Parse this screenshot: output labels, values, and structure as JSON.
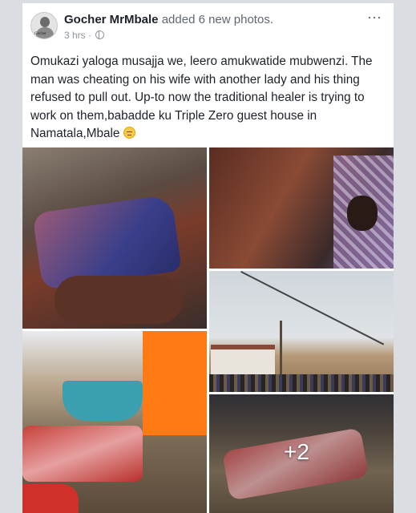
{
  "post": {
    "author": "Gocher MrMbale",
    "action": "added 6 new photos.",
    "time": "3 hrs",
    "separator": "·",
    "audience_icon": "globe-icon",
    "menu_icon": "more-options-icon",
    "menu_glyph": "⋯",
    "text": "Omukazi yaloga musajja we,  leero amukwatide mubwenzi. The man was cheating on his wife with another lady and his thing refused to pull out. Up-to now the traditional healer is trying to work on them,babadde ku Triple Zero guest house in Namatala,Mbale",
    "emoji_icon": "grimacing-face-emoji"
  },
  "avatar": {
    "caption": "Gocher"
  },
  "photos": {
    "count_total": 6,
    "more_label": "+2"
  },
  "colors": {
    "name": "#1d2129",
    "meta": "#90949c",
    "background": "#dadde1",
    "card": "#ffffff"
  }
}
